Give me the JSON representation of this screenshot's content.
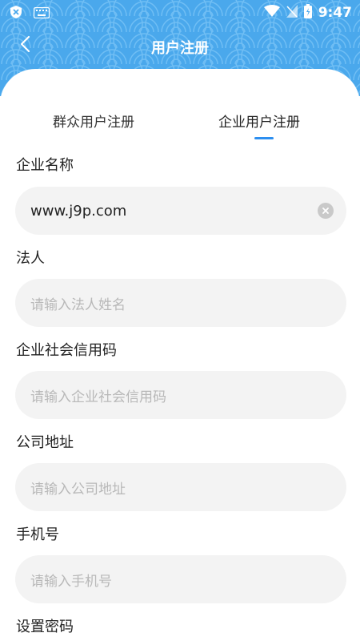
{
  "status_bar": {
    "time": "9:47"
  },
  "nav": {
    "title": "用户注册"
  },
  "tabs": [
    {
      "label": "群众用户注册",
      "active": false
    },
    {
      "label": "企业用户注册",
      "active": true
    }
  ],
  "form": {
    "company_name": {
      "label": "企业名称",
      "value": "www.j9p.com"
    },
    "legal_person": {
      "label": "法人",
      "placeholder": "请输入法人姓名"
    },
    "credit_code": {
      "label": "企业社会信用码",
      "placeholder": "请输入企业社会信用码"
    },
    "address": {
      "label": "公司地址",
      "placeholder": "请输入公司地址"
    },
    "phone": {
      "label": "手机号",
      "placeholder": "请输入手机号"
    },
    "password": {
      "label": "设置密码"
    }
  },
  "colors": {
    "header": "#4aa8ec",
    "accent": "#2d8ff0",
    "input_bg": "#f3f3f3"
  }
}
